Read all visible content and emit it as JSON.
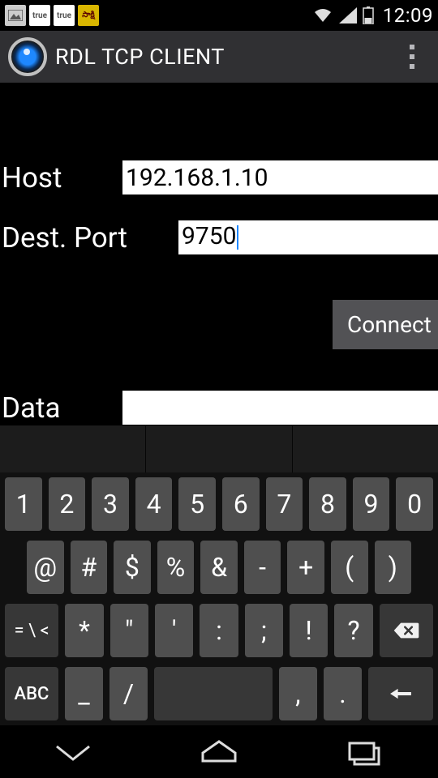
{
  "status_bar": {
    "time": "12:09",
    "app_icons": [
      "picture",
      "true",
      "true",
      "sakshi"
    ],
    "right_icons": [
      "wifi",
      "signal",
      "battery"
    ]
  },
  "action_bar": {
    "title": "RDL TCP CLIENT",
    "overflow_menu": "more-options"
  },
  "form": {
    "host_label": "Host",
    "host_value": "192.168.1.10",
    "port_label": "Dest. Port",
    "port_value": "9750",
    "data_label": "Data",
    "data_value": ""
  },
  "buttons": {
    "connect_label": "Connect"
  },
  "keyboard": {
    "row1": [
      "1",
      "2",
      "3",
      "4",
      "5",
      "6",
      "7",
      "8",
      "9",
      "0"
    ],
    "row2": [
      "@",
      "#",
      "$",
      "%",
      "&",
      "-",
      "+",
      "(",
      ")"
    ],
    "row3_shift": "= \\ <",
    "row3": [
      "*",
      "\"",
      "'",
      ":",
      ";",
      "!",
      "?"
    ],
    "row3_backspace": "backspace",
    "row4_mode": "ABC",
    "row4": [
      "_",
      "/"
    ],
    "row4_space": "space",
    "row4_right": [
      ",",
      "."
    ],
    "row4_enter": "enter"
  }
}
